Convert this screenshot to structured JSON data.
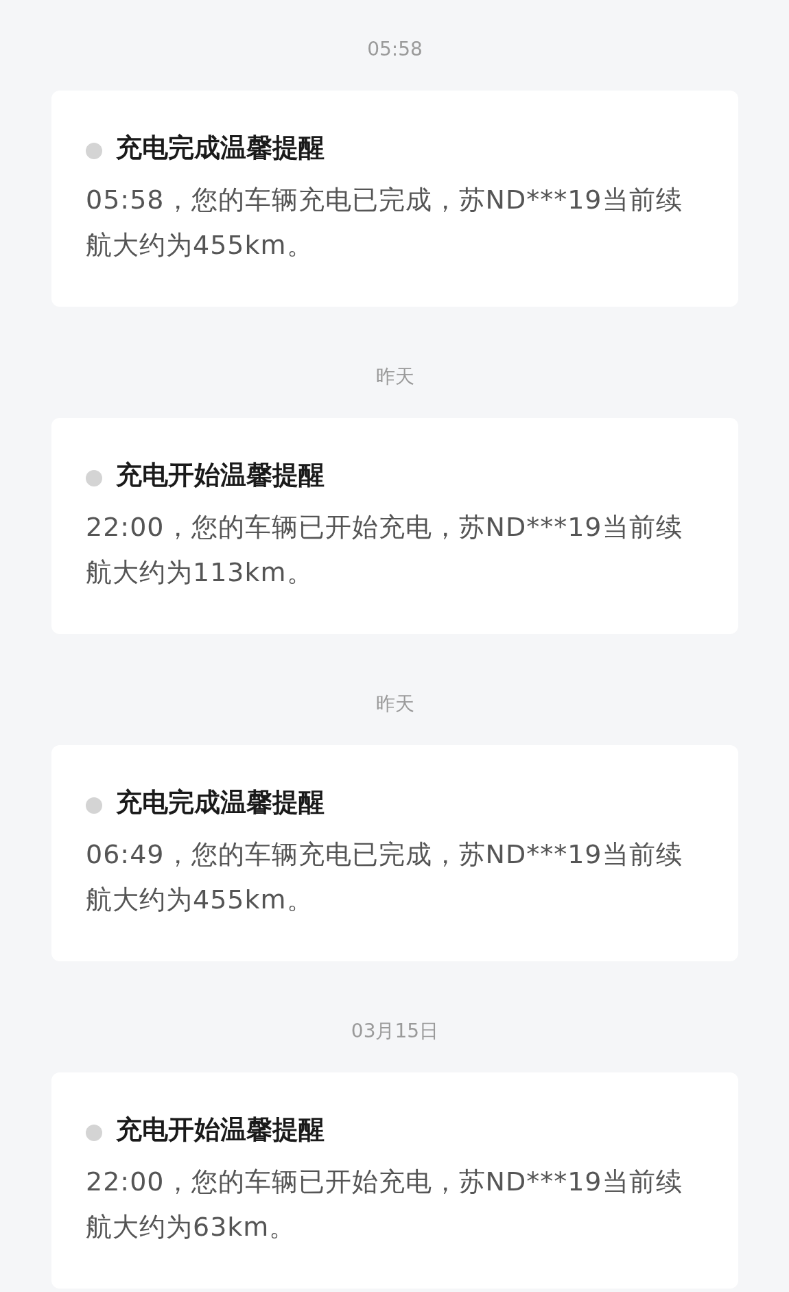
{
  "messages": [
    {
      "time": "05:58",
      "title": "充电完成温馨提醒",
      "body": "05:58，您的车辆充电已完成，苏ND***19当前续航大约为455km。"
    },
    {
      "time": "昨天",
      "title": "充电开始温馨提醒",
      "body": "22:00，您的车辆已开始充电，苏ND***19当前续航大约为113km。"
    },
    {
      "time": "昨天",
      "title": "充电完成温馨提醒",
      "body": "06:49，您的车辆充电已完成，苏ND***19当前续航大约为455km。"
    },
    {
      "time": "03月15日",
      "title": "充电开始温馨提醒",
      "body": "22:00，您的车辆已开始充电，苏ND***19当前续航大约为63km。"
    }
  ]
}
